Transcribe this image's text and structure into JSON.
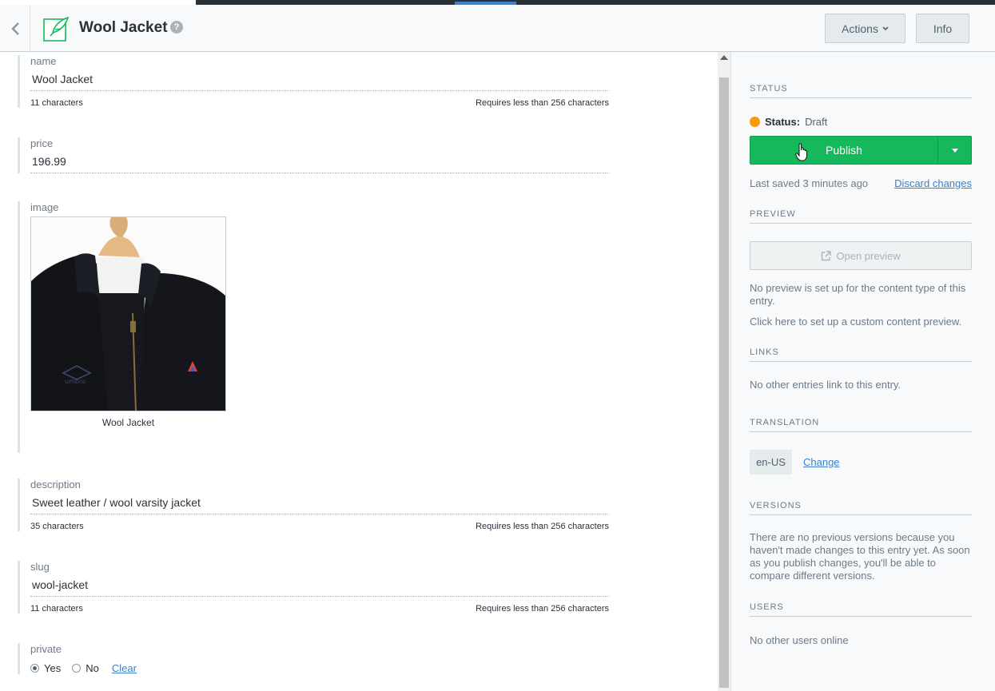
{
  "header": {
    "title": "Wool Jacket",
    "help_glyph": "?",
    "actions_label": "Actions",
    "info_label": "Info"
  },
  "fields": {
    "name": {
      "label": "name",
      "value": "Wool Jacket",
      "count": "11 characters",
      "limit": "Requires less than 256 characters"
    },
    "price": {
      "label": "price",
      "value": "196.99"
    },
    "image": {
      "label": "image",
      "caption": "Wool Jacket",
      "logo_text": "umbro"
    },
    "description": {
      "label": "description",
      "value": "Sweet leather / wool varsity jacket",
      "count": "35 characters",
      "limit": "Requires less than 256 characters"
    },
    "slug": {
      "label": "slug",
      "value": "wool-jacket",
      "count": "11 characters",
      "limit": "Requires less than 256 characters"
    },
    "private": {
      "label": "private",
      "options": [
        "Yes",
        "No"
      ],
      "selected": "Yes",
      "clear_label": "Clear"
    }
  },
  "sidebar": {
    "status": {
      "title": "STATUS",
      "label": "Status:",
      "value": "Draft",
      "color": "#f79b0c",
      "publish_label": "Publish",
      "last_saved": "Last saved 3 minutes ago",
      "discard_label": "Discard changes"
    },
    "preview": {
      "title": "PREVIEW",
      "button_label": "Open preview",
      "message": "No preview is set up for the content type of this entry.",
      "setup_link": "Click here to set up a custom content preview."
    },
    "links": {
      "title": "LINKS",
      "message": "No other entries link to this entry."
    },
    "translation": {
      "title": "TRANSLATION",
      "locale": "en-US",
      "change_label": "Change"
    },
    "versions": {
      "title": "VERSIONS",
      "message": "There are no previous versions because you haven't made changes to this entry yet. As soon as you publish changes, you'll be able to compare different versions."
    },
    "users": {
      "title": "USERS",
      "message": "No other users online"
    }
  },
  "colors": {
    "accent": "#3c80cf",
    "publish_green": "#16b85c",
    "draft_orange": "#f79b0c"
  }
}
